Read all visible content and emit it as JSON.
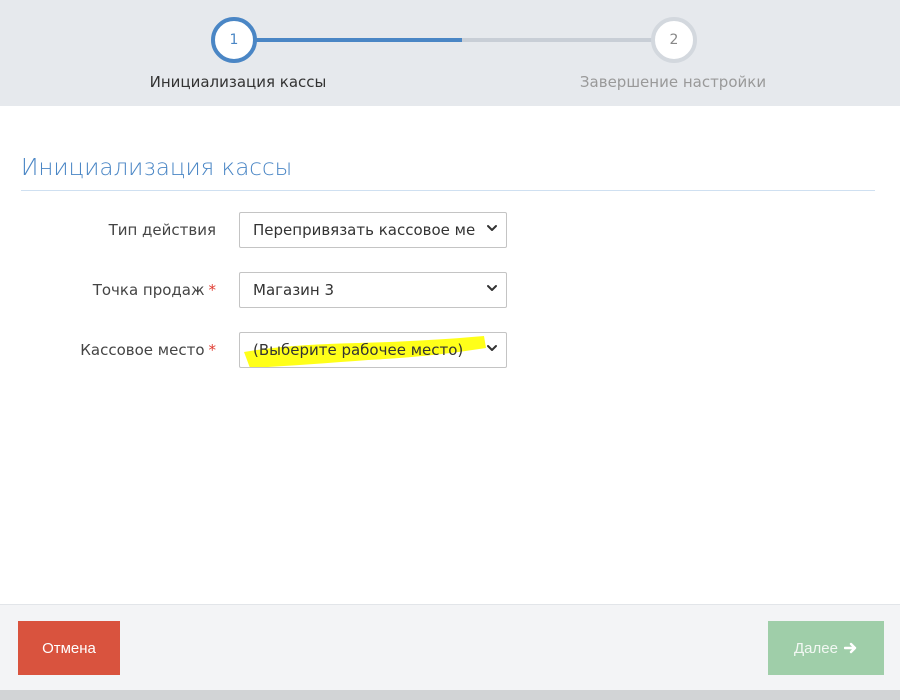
{
  "wizard": {
    "steps": [
      {
        "number": "1",
        "label": "Инициализация кассы",
        "state": "active"
      },
      {
        "number": "2",
        "label": "Завершение настройки",
        "state": "pending"
      }
    ]
  },
  "form": {
    "title": "Инициализация кассы",
    "fields": [
      {
        "label": "Тип действия",
        "required": false,
        "value": "Перепривязать кассовое ме"
      },
      {
        "label": "Точка продаж",
        "required": true,
        "value": "Магазин 3"
      },
      {
        "label": "Кассовое место",
        "required": true,
        "value": "(Выберите рабочее место)"
      }
    ],
    "required_marker": "*"
  },
  "footer": {
    "cancel_label": "Отмена",
    "next_label": "Далее"
  },
  "colors": {
    "accent": "#4a86c5",
    "cancel": "#d9533e",
    "next_disabled": "#9fcea9",
    "highlight": "#ffff00"
  },
  "icons": {
    "select_caret": "chevron-down-icon",
    "next_arrow": "arrow-right-icon"
  }
}
